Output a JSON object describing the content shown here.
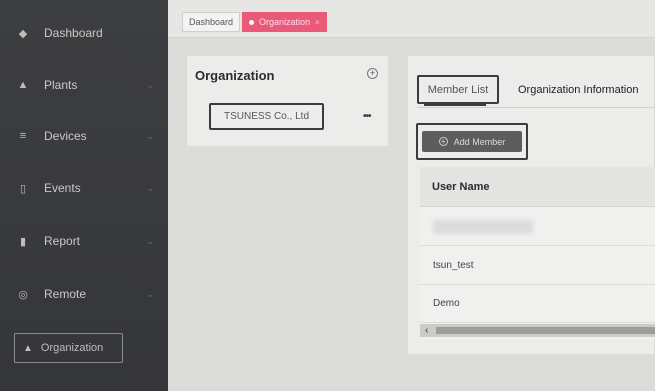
{
  "sidebar": {
    "items": [
      {
        "label": "Dashboard",
        "icon": "dashboard-icon"
      },
      {
        "label": "Plants",
        "icon": "plant-icon"
      },
      {
        "label": "Devices",
        "icon": "devices-icon"
      },
      {
        "label": "Events",
        "icon": "events-icon"
      },
      {
        "label": "Report",
        "icon": "report-icon"
      },
      {
        "label": "Remote",
        "icon": "remote-icon"
      }
    ],
    "active": {
      "label": "Organization",
      "icon": "organization-icon"
    }
  },
  "tabs": [
    {
      "label": "Dashboard"
    },
    {
      "label": "Organization"
    }
  ],
  "org_panel": {
    "title": "Organization",
    "node_label": "TSUNESS Co., Ltd",
    "more_label": "•••"
  },
  "member_panel": {
    "tabs": [
      {
        "label": "Member List"
      },
      {
        "label": "Organization Information"
      }
    ],
    "add_button": "Add Member",
    "table": {
      "columns": [
        "User Name"
      ],
      "rows": [
        "tsun_test",
        "Demo"
      ]
    }
  },
  "colors": {
    "sidebar_bg": "#3a3b3d",
    "accent": "#e85a78",
    "button_bg": "#5d5d5d"
  }
}
